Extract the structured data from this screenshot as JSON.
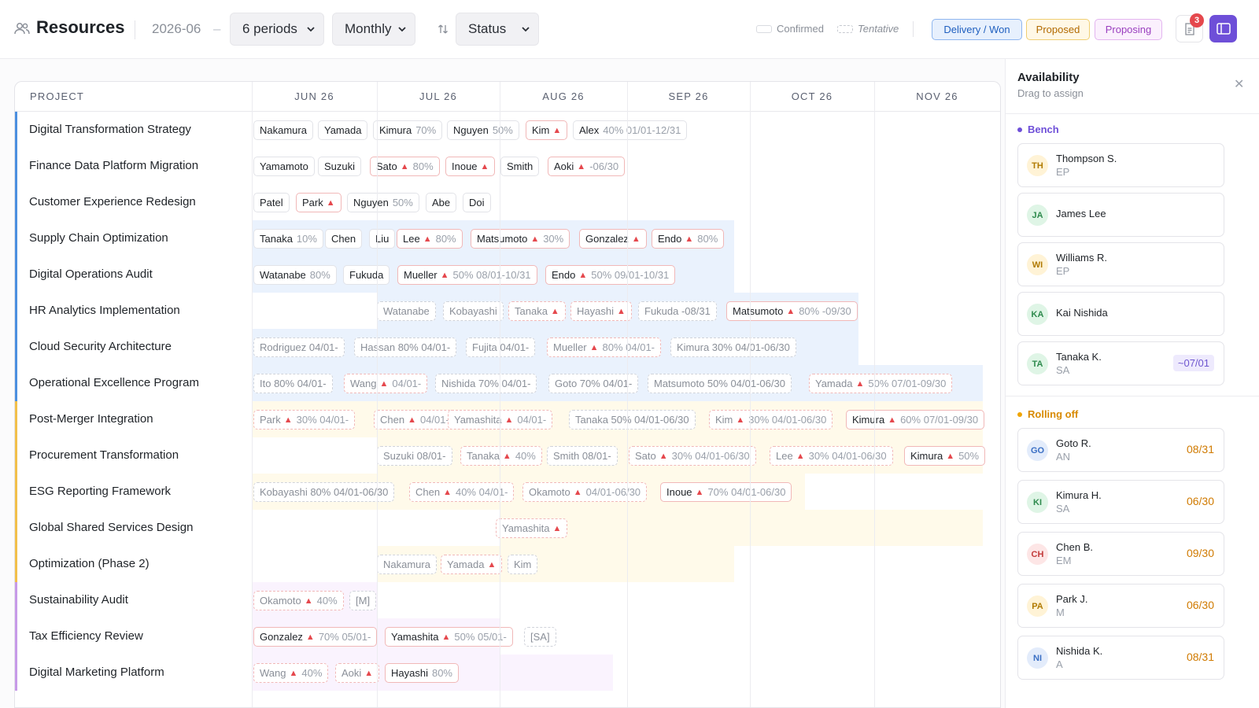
{
  "header": {
    "title": "Resources",
    "period": "2026-06",
    "period_dash": "–",
    "periods_select": "6 periods",
    "granularity_select": "Monthly",
    "status_select": "Status",
    "legend_confirmed": "Confirmed",
    "legend_tentative": "Tentative",
    "badges": [
      "Delivery / Won",
      "Proposed",
      "Proposing"
    ],
    "notification_count": "3"
  },
  "grid": {
    "project_header": "PROJECT",
    "months": [
      "JUN 26",
      "JUL 26",
      "AUG 26",
      "SEP 26",
      "OCT 26",
      "NOV 26"
    ],
    "rows": [
      {
        "name": "Digital Transformation Strategy",
        "chips": [
          {
            "label": "Nakamura"
          },
          {
            "label": "Yamada"
          },
          {
            "label": "Kimura",
            "note": "70%"
          },
          {
            "label": "Nguyen",
            "note": "50%"
          },
          {
            "label": "Kim",
            "warn": true
          },
          {
            "label": "Alex",
            "note": "40% 01/01-12/31"
          }
        ]
      },
      {
        "name": "Finance Data Platform Migration",
        "chips": [
          {
            "label": "Yamamoto"
          },
          {
            "label": "Suzuki"
          },
          {
            "label": "Sato",
            "warn": true,
            "note": "80%"
          },
          {
            "label": "Inoue",
            "warn": true
          },
          {
            "label": "Smith"
          },
          {
            "label": "Aoki",
            "warn": true,
            "note": "-06/30"
          }
        ]
      },
      {
        "name": "Customer Experience Redesign",
        "chips": [
          {
            "label": "Patel"
          },
          {
            "label": "Park",
            "warn": true
          },
          {
            "label": "Nguyen",
            "note": "50%"
          },
          {
            "label": "Abe"
          },
          {
            "label": "Doi"
          }
        ]
      },
      {
        "name": "Supply Chain Optimization",
        "chips": [
          {
            "label": "Tanaka",
            "note": "10%"
          },
          {
            "label": "Chen"
          },
          {
            "label": "Liu"
          },
          {
            "label": "Lee",
            "warn": true,
            "note": "80%"
          },
          {
            "label": "Matsumoto",
            "warn": true,
            "note": "30%"
          },
          {
            "label": "Gonzalez",
            "warn": true
          },
          {
            "label": "Endo",
            "warn": true,
            "note": "80%"
          }
        ]
      },
      {
        "name": "Digital Operations Audit",
        "chips": [
          {
            "label": "Watanabe",
            "note": "80%"
          },
          {
            "label": "Fukuda"
          },
          {
            "label": "Mueller",
            "warn": true,
            "note": "50% 08/01-10/31"
          },
          {
            "label": "Endo",
            "warn": true,
            "note": "50% 09/01-10/31"
          }
        ]
      },
      {
        "name": "HR Analytics Implementation",
        "chips": [
          {
            "label": "Watanabe"
          },
          {
            "label": "Kobayashi"
          },
          {
            "label": "Tanaka",
            "warn": true
          },
          {
            "label": "Hayashi",
            "warn": true
          },
          {
            "label": "Fukuda -08/31"
          },
          {
            "label": "Matsumoto",
            "warn": true,
            "note": "80% -09/30"
          }
        ]
      },
      {
        "name": "Cloud Security Architecture",
        "chips": [
          {
            "label": "Rodriguez 04/01-"
          },
          {
            "label": "Hassan 80% 04/01-"
          },
          {
            "label": "Fujita 04/01-"
          },
          {
            "label": "Mueller",
            "warn": true,
            "note": "80% 04/01-"
          },
          {
            "label": "Kimura 30% 04/01-06/30"
          }
        ]
      },
      {
        "name": "Operational Excellence Program",
        "chips": [
          {
            "label": "Ito 80% 04/01-"
          },
          {
            "label": "Wang",
            "warn": true,
            "note": "04/01-"
          },
          {
            "label": "Nishida 70% 04/01-"
          },
          {
            "label": "Goto 70% 04/01-"
          },
          {
            "label": "Matsumoto 50% 04/01-06/30"
          },
          {
            "label": "Yamada",
            "warn": true,
            "note": "50% 07/01-09/30"
          }
        ]
      },
      {
        "name": "Post-Merger Integration",
        "chips": [
          {
            "label": "Park",
            "warn": true,
            "note": "30% 04/01-"
          },
          {
            "label": "Chen",
            "warn": true,
            "note": "04/01-"
          },
          {
            "label": "Yamashita",
            "warn": true,
            "note": "04/01-"
          },
          {
            "label": "Tanaka 50% 04/01-06/30"
          },
          {
            "label": "Kim",
            "warn": true,
            "note": "30% 04/01-06/30"
          },
          {
            "label": "Kimura",
            "warn": true,
            "note": "60% 07/01-09/30"
          }
        ]
      },
      {
        "name": "Procurement Transformation",
        "chips": [
          {
            "label": "Suzuki 08/01-"
          },
          {
            "label": "Tanaka",
            "warn": true,
            "note": "40%"
          },
          {
            "label": "Smith 08/01-"
          },
          {
            "label": "Sato",
            "warn": true,
            "note": "30% 04/01-06/30"
          },
          {
            "label": "Lee",
            "warn": true,
            "note": "30% 04/01-06/30"
          },
          {
            "label": "Kimura",
            "warn": true,
            "note": "50%"
          }
        ]
      },
      {
        "name": "ESG Reporting Framework",
        "chips": [
          {
            "label": "Kobayashi 80% 04/01-06/30"
          },
          {
            "label": "Chen",
            "warn": true,
            "note": "40% 04/01-"
          },
          {
            "label": "Okamoto",
            "warn": true,
            "note": "04/01-06/30"
          },
          {
            "label": "Inoue",
            "warn": true,
            "note": "70% 04/01-06/30"
          }
        ]
      },
      {
        "name": "Global Shared Services Design",
        "chips": [
          {
            "label": "Yamashita",
            "warn": true
          }
        ]
      },
      {
        "name": "Optimization (Phase 2)",
        "chips": [
          {
            "label": "Nakamura"
          },
          {
            "label": "Yamada",
            "warn": true
          },
          {
            "label": "Kim"
          }
        ]
      },
      {
        "name": "Sustainability Audit",
        "chips": [
          {
            "label": "Okamoto",
            "warn": true,
            "note": "40%"
          },
          {
            "label": "[M]"
          }
        ]
      },
      {
        "name": "Tax Efficiency Review",
        "chips": [
          {
            "label": "Gonzalez",
            "warn": true,
            "note": "70% 05/01-"
          },
          {
            "label": "Yamashita",
            "warn": true,
            "note": "50% 05/01-"
          },
          {
            "label": "[SA]"
          }
        ]
      },
      {
        "name": "Digital Marketing Platform",
        "chips": [
          {
            "label": "Wang",
            "warn": true,
            "note": "40%"
          },
          {
            "label": "Aoki",
            "warn": true
          },
          {
            "label": "Hayashi",
            "note": "80%"
          }
        ]
      }
    ]
  },
  "panel": {
    "title": "Availability",
    "subtitle": "Drag to assign",
    "bench_title": "Bench",
    "rolling_title": "Rolling off",
    "bench": [
      {
        "initials": "TH",
        "name": "Thompson S.",
        "role": "EP"
      },
      {
        "initials": "JA",
        "name": "James Lee",
        "role": ""
      },
      {
        "initials": "WI",
        "name": "Williams R.",
        "role": "EP"
      },
      {
        "initials": "KA",
        "name": "Kai Nishida",
        "role": ""
      },
      {
        "initials": "TA",
        "name": "Tanaka K.",
        "role": "SA",
        "date": "~07/01"
      }
    ],
    "rolling": [
      {
        "initials": "GO",
        "name": "Goto R.",
        "role": "AN",
        "date": "08/31"
      },
      {
        "initials": "KI",
        "name": "Kimura H.",
        "role": "SA",
        "date": "06/30"
      },
      {
        "initials": "CH",
        "name": "Chen B.",
        "role": "EM",
        "date": "09/30"
      },
      {
        "initials": "PA",
        "name": "Park J.",
        "role": "M",
        "date": "06/30"
      },
      {
        "initials": "NI",
        "name": "Nishida K.",
        "role": "A",
        "date": "08/31"
      }
    ]
  }
}
